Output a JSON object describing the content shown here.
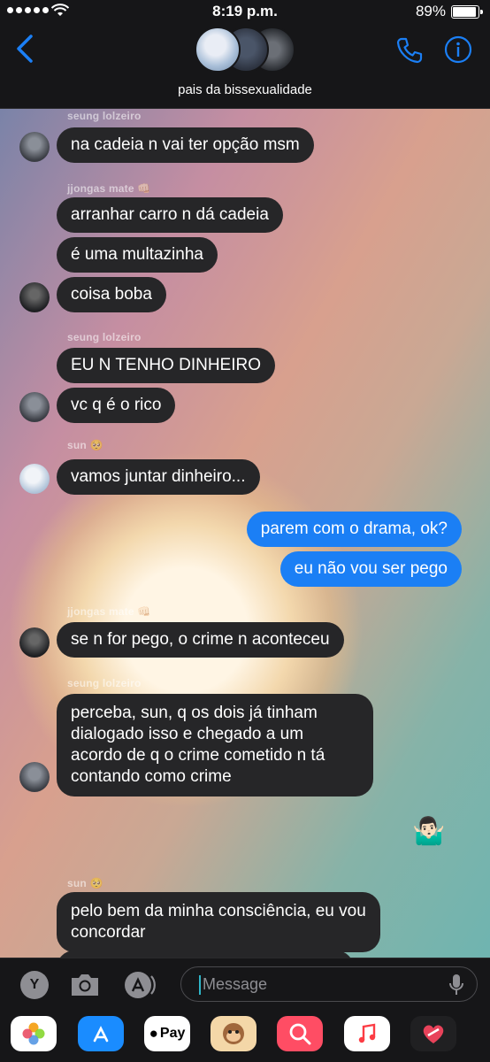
{
  "status_bar": {
    "time": "8:19 p.m.",
    "battery": "89%",
    "battery_level": 0.89
  },
  "header": {
    "group_name": "pais da bissexualidade",
    "accent_color": "#1b7ff5",
    "icons": [
      "back-chevron-icon",
      "phone-icon",
      "info-icon"
    ]
  },
  "messages": [
    {
      "sender": "seung lolzeiro",
      "text": "na cadeia n vai ter opção msm"
    },
    {
      "sender": "jjongas mate 👊🏻",
      "text": "arranhar carro n dá cadeia"
    },
    {
      "text": "é uma multazinha"
    },
    {
      "text": "coisa boba"
    },
    {
      "sender": "seung lolzeiro",
      "text": "EU N TENHO DINHEIRO"
    },
    {
      "text": "vc q é o rico"
    },
    {
      "sender": "sun 🥺",
      "text": "vamos juntar dinheiro..."
    },
    {
      "sender": "me",
      "text": "parem com o drama, ok?"
    },
    {
      "sender": "me",
      "text": "eu não vou ser pego"
    },
    {
      "sender": "jjongas mate 👊🏻",
      "text": "se n for pego, o crime n aconteceu"
    },
    {
      "sender": "seung lolzeiro",
      "text": "perceba, sun, q os dois já tinham dialogado isso e chegado a um acordo de q o crime cometido n tá contando como crime"
    },
    {
      "sender": "me",
      "text": "🤷🏻‍♂️"
    },
    {
      "sender": "sun 🥺",
      "text": "pelo bem da minha consciência, eu vou concordar"
    }
  ],
  "input": {
    "placeholder": "Message"
  },
  "app_drawer": {
    "pay_label": "Pay",
    "apps": [
      "photos-icon",
      "app-store-icon",
      "apple-pay-icon",
      "memoji-icon",
      "search-images-icon",
      "music-icon",
      "digital-touch-icon"
    ]
  }
}
